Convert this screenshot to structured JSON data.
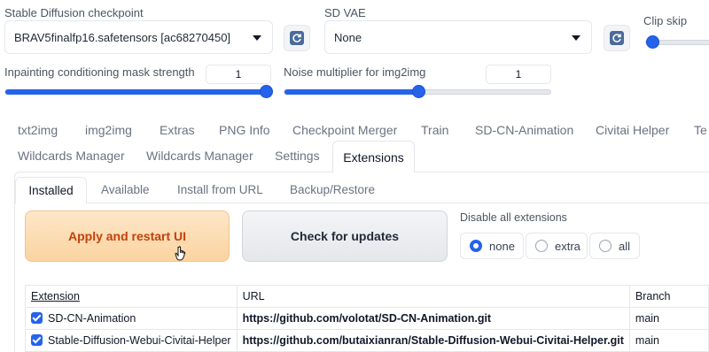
{
  "top": {
    "checkpoint": {
      "label": "Stable Diffusion checkpoint",
      "value": "BRAV5finalfp16.safetensors [ac68270450]"
    },
    "vae": {
      "label": "SD VAE",
      "value": "None"
    },
    "clip_skip": {
      "label": "Clip skip"
    },
    "inpaint_mask": {
      "label": "Inpainting conditioning mask strength",
      "value": "1",
      "level": 1.0
    },
    "noise_mult": {
      "label": "Noise multiplier for img2img",
      "value": "1",
      "level": 0.5
    }
  },
  "tabs_row1": [
    "txt2img",
    "img2img",
    "Extras",
    "PNG Info",
    "Checkpoint Merger",
    "Train",
    "SD-CN-Animation",
    "Civitai Helper",
    "Te"
  ],
  "tabs_row2": [
    "Wildcards Manager",
    "Wildcards Manager",
    "Settings",
    "Extensions"
  ],
  "active_tab": "Extensions",
  "subtabs": [
    "Installed",
    "Available",
    "Install from URL",
    "Backup/Restore"
  ],
  "buttons": {
    "apply": "Apply and restart UI",
    "check": "Check for updates"
  },
  "disable_all": {
    "label": "Disable all extensions",
    "options": [
      "none",
      "extra",
      "all"
    ],
    "selected": "none"
  },
  "table": {
    "headers": [
      "Extension",
      "URL",
      "Branch"
    ],
    "rows": [
      {
        "checked": true,
        "name": "SD-CN-Animation",
        "url": "https://github.com/volotat/SD-CN-Animation.git",
        "branch": "main"
      },
      {
        "checked": true,
        "name": "Stable-Diffusion-Webui-Civitai-Helper",
        "url": "https://github.com/butaixianran/Stable-Diffusion-Webui-Civitai-Helper.git",
        "branch": "main"
      }
    ]
  },
  "icons": {
    "refresh": "refresh-icon",
    "cursor": "hand-pointer-cursor"
  }
}
